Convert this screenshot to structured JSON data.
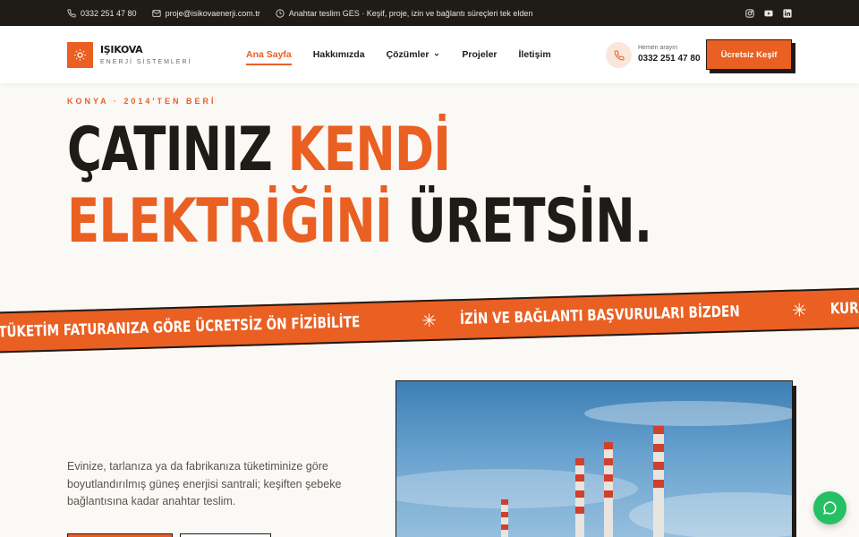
{
  "topbar": {
    "phone": "0332 251 47 80",
    "email": "proje@isikovaenerji.com.tr",
    "info": "Anahtar teslim GES · Keşif, proje, izin ve bağlantı süreçleri tek elden",
    "social": [
      "instagram-icon",
      "youtube-icon",
      "linkedin-icon"
    ]
  },
  "brand": {
    "name": "IŞIKOVA",
    "sub": "ENERJİ SİSTEMLERİ"
  },
  "nav": {
    "items": [
      {
        "label": "Ana Sayfa",
        "active": true
      },
      {
        "label": "Hakkımızda"
      },
      {
        "label": "Çözümler",
        "dropdown": true
      },
      {
        "label": "Projeler"
      },
      {
        "label": "İletişim"
      }
    ]
  },
  "contact": {
    "small": "Hemen arayın",
    "phone": "0332 251 47 80"
  },
  "cta": {
    "label": "Ücretsiz Keşif"
  },
  "hero": {
    "eyebrow": "KONYA · 2014'TEN BERİ",
    "line1a": "ÇATINIZ ",
    "line1b": "KENDİ",
    "line2a": "ELEKTRİĞİNİ",
    "line2b": " ÜRETSİN."
  },
  "ribbon": {
    "items": [
      "TÜKETİM FATURANIZA GÖRE ÜCRETSİZ ÖN FİZİBİLİTE",
      "İZİN VE BAĞLANTI BAŞVURULARI BİZDEN",
      "KURULUM SONRASI UZAKTAN ÜRETİM İZLEME"
    ],
    "separator": "✳"
  },
  "lead": "Evinize, tarlanıza ya da fabrikanıza tüketiminize göre boyutlandırılmış güneş enerjisi santrali; keşiften şebeke bağlantısına kadar anahtar teslim.",
  "colors": {
    "accent": "#ea5f22",
    "dark": "#1f1b17",
    "whatsapp": "#25c064"
  }
}
